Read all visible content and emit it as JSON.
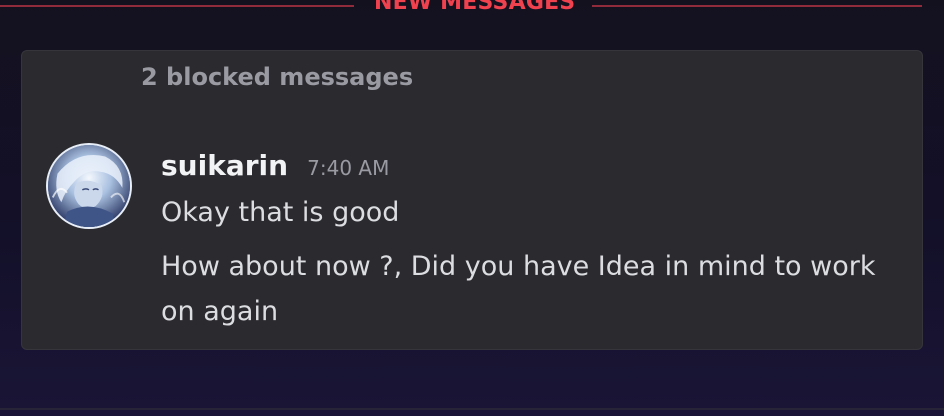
{
  "divider": {
    "label": "NEW MESSAGES",
    "color": "#f0414f"
  },
  "card": {
    "blocked_text": "2 blocked messages"
  },
  "message": {
    "username": "suikarin",
    "timestamp": "7:40 AM",
    "line1": "Okay that is good",
    "line2": "How about now ?, Did you have Idea in mind to work",
    "line3": "on again",
    "avatar_icon": "user-avatar"
  },
  "colors": {
    "background": "#14111f",
    "card": "#2b2b2f",
    "accent_red": "#f0414f",
    "text_primary": "#f2f3f5",
    "text_muted": "#9a9aa3"
  }
}
